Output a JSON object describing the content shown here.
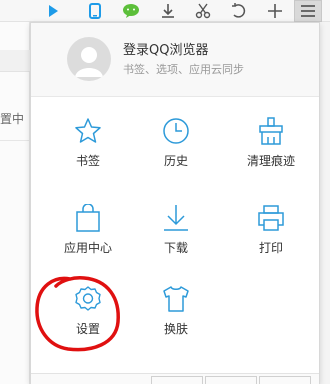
{
  "toolbar": {
    "buttons": [
      {
        "name": "play-icon",
        "color": "#1e9be8"
      },
      {
        "name": "phone-icon",
        "color": "#1e9be8"
      },
      {
        "name": "wechat-icon",
        "color": "#5cbf3a"
      },
      {
        "name": "download-icon",
        "color": "#555555"
      },
      {
        "name": "scissors-icon",
        "color": "#555555"
      },
      {
        "name": "undo-icon",
        "color": "#555555"
      },
      {
        "name": "plus-icon",
        "color": "#555555"
      },
      {
        "name": "menu-icon",
        "color": "#555555"
      }
    ]
  },
  "background": {
    "partial_text": "置中"
  },
  "popup": {
    "login_title": "登录QQ浏览器",
    "login_subtitle": "书签、选项、应用云同步",
    "items": [
      {
        "label": "书签",
        "icon": "star-icon"
      },
      {
        "label": "历史",
        "icon": "clock-icon"
      },
      {
        "label": "清理痕迹",
        "icon": "broom-icon"
      },
      {
        "label": "应用中心",
        "icon": "bag-icon"
      },
      {
        "label": "下载",
        "icon": "download-icon"
      },
      {
        "label": "打印",
        "icon": "printer-icon"
      },
      {
        "label": "设置",
        "icon": "gear-icon"
      },
      {
        "label": "换肤",
        "icon": "shirt-icon"
      }
    ],
    "accent_color": "#2d9ad9"
  },
  "annotation": {
    "color": "#e01010"
  }
}
